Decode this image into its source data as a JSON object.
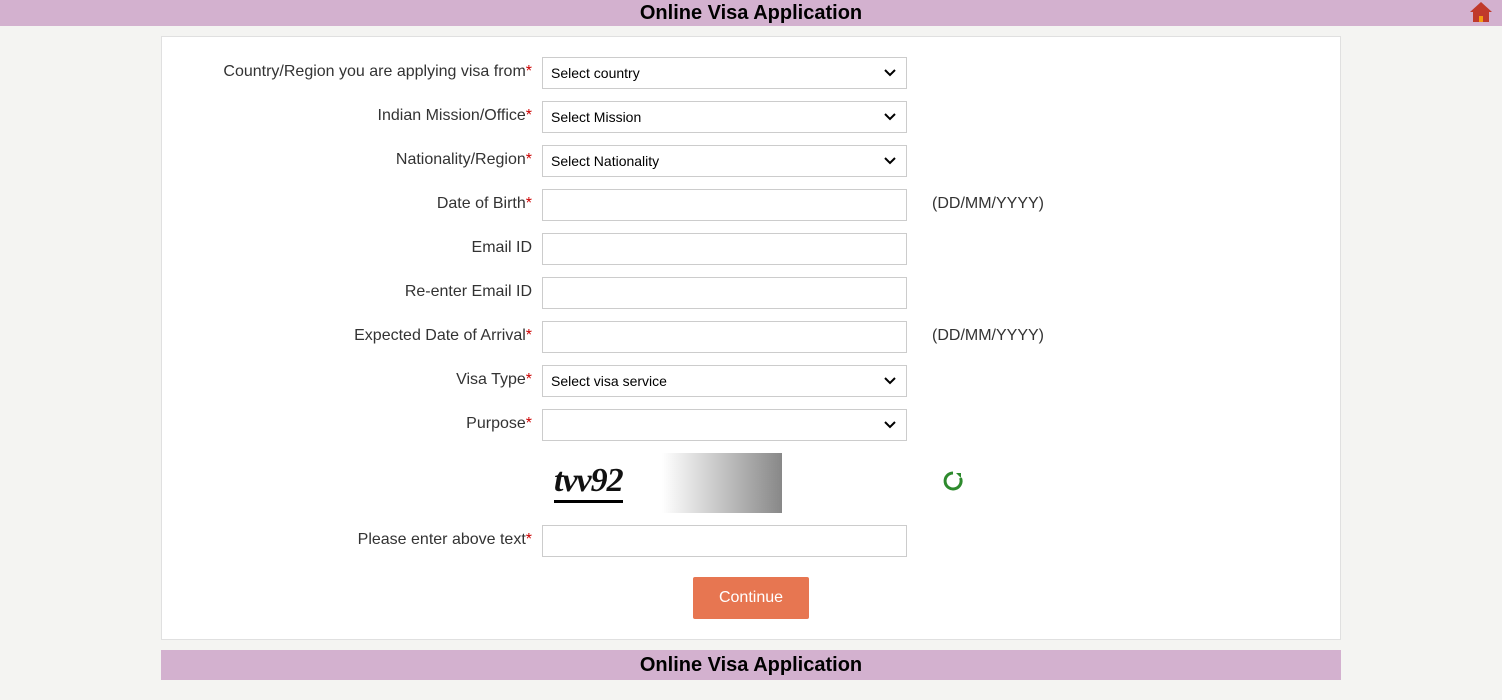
{
  "header": {
    "title": "Online Visa Application"
  },
  "form": {
    "country": {
      "label": "Country/Region you are applying visa from",
      "placeholder": "Select country"
    },
    "mission": {
      "label": "Indian Mission/Office",
      "placeholder": "Select Mission"
    },
    "nationality": {
      "label": "Nationality/Region",
      "placeholder": "Select Nationality"
    },
    "dob": {
      "label": "Date of Birth",
      "hint": "(DD/MM/YYYY)"
    },
    "email": {
      "label": "Email ID"
    },
    "reemail": {
      "label": "Re-enter Email ID"
    },
    "arrival": {
      "label": "Expected Date of Arrival",
      "hint": "(DD/MM/YYYY)"
    },
    "visatype": {
      "label": "Visa Type",
      "placeholder": "Select visa service"
    },
    "purpose": {
      "label": "Purpose"
    },
    "captcha": {
      "text": "tvv92",
      "input_label": "Please enter above text"
    },
    "continue_label": "Continue"
  },
  "footer": {
    "title": "Online Visa Application"
  }
}
